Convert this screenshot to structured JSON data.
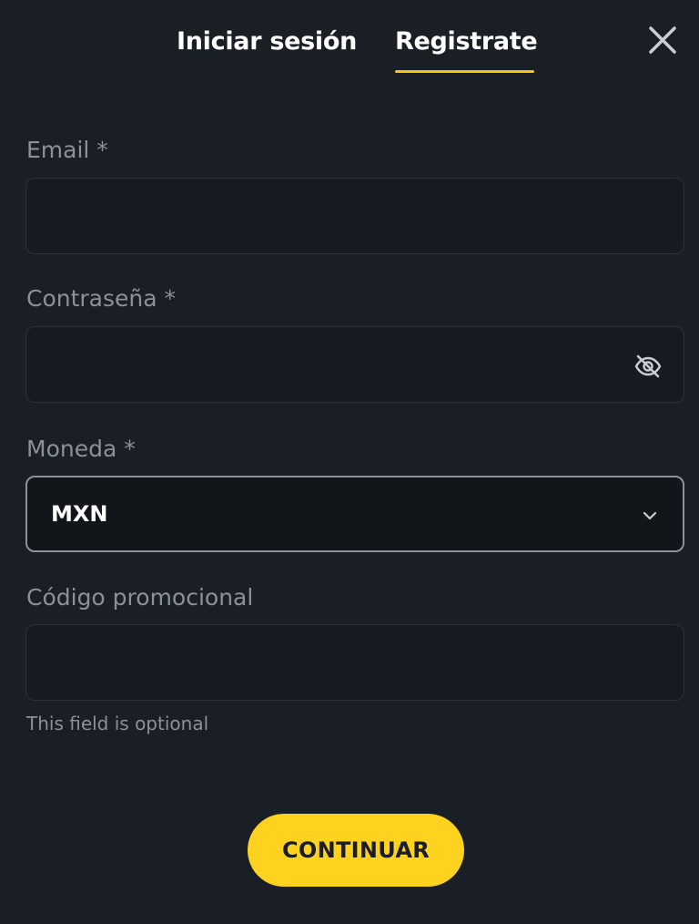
{
  "tabs": {
    "login_label": "Iniciar sesión",
    "register_label": "Registrate",
    "active": "register"
  },
  "form": {
    "email": {
      "label": "Email *",
      "value": "",
      "placeholder": ""
    },
    "password": {
      "label": "Contraseña *",
      "value": "",
      "placeholder": ""
    },
    "currency": {
      "label": "Moneda *",
      "value": "MXN"
    },
    "promo": {
      "label": "Código promocional",
      "value": "",
      "placeholder": "",
      "hint": "This field is optional"
    }
  },
  "actions": {
    "continue_label": "CONTINUAR"
  },
  "colors": {
    "background": "#1a1f26",
    "accent": "#ffd21f",
    "label": "#8a919b"
  },
  "icons": {
    "close": "close-icon",
    "password_toggle": "eye-off-icon",
    "dropdown": "chevron-down-icon"
  }
}
